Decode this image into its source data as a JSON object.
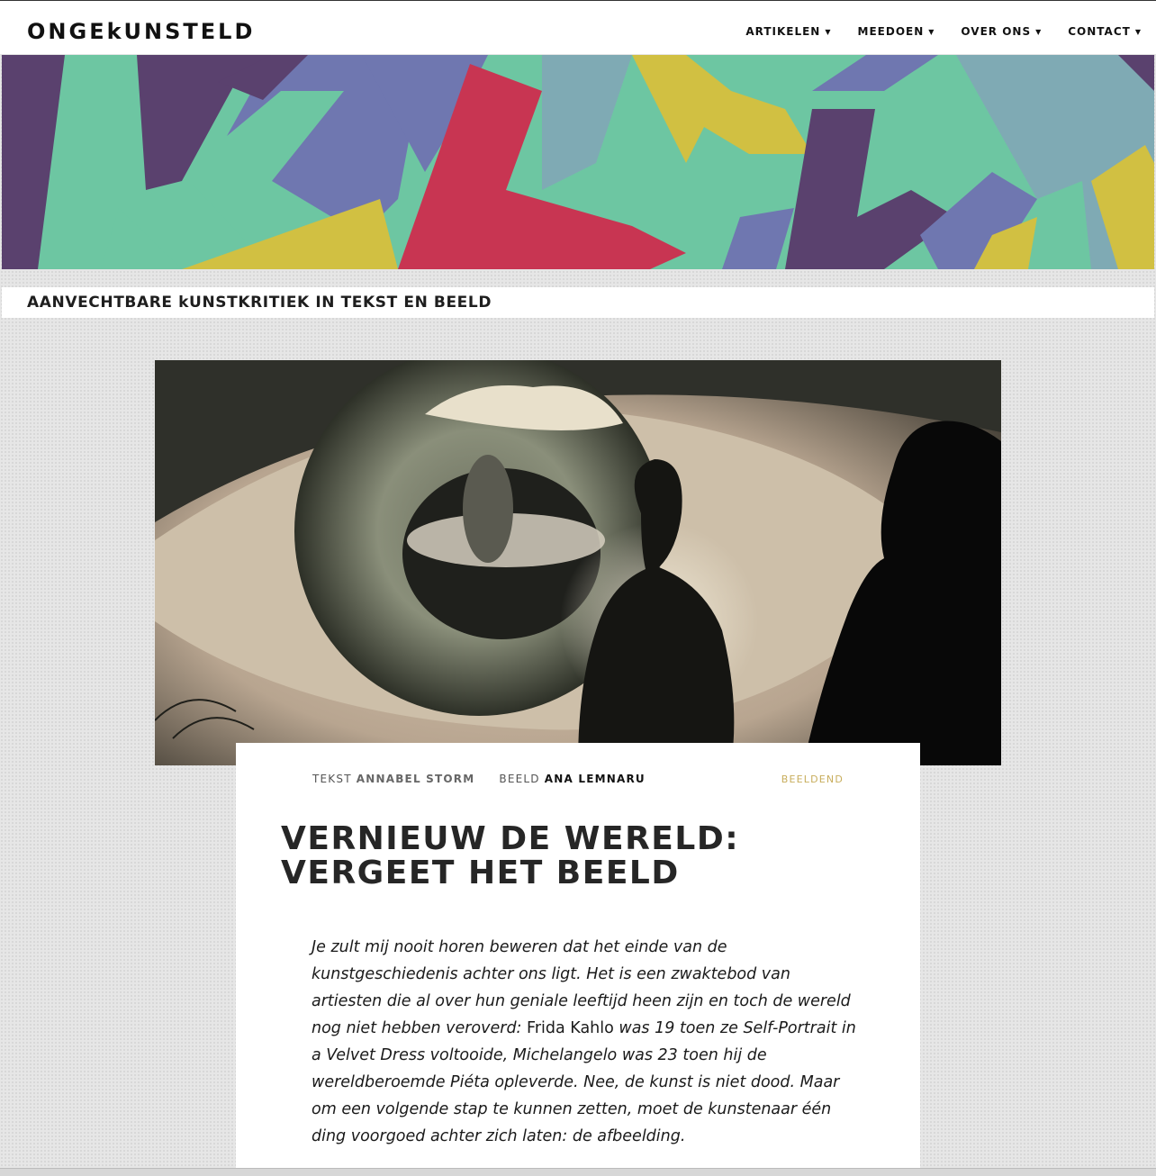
{
  "site": {
    "brand": "ONGEkUNSTELD",
    "tagline": "AANVECHTBARE kUNSTKRITIEK IN TEKST EN BEELD"
  },
  "nav": [
    {
      "label": "ARTIKELEN"
    },
    {
      "label": "MEEDOEN"
    },
    {
      "label": "OVER ONS"
    },
    {
      "label": "CONTACT"
    }
  ],
  "article": {
    "tekst_label": "TEKST",
    "author": "ANNABEL STORM",
    "beeld_label": "BEELD",
    "illustrator": "ANA LEMNARU",
    "category": "BEELDEND",
    "title": "VERNIEUW DE WERELD: VERGEET HET BEELD",
    "intro": {
      "p1": "Je zult mij nooit horen beweren dat het einde van de kunstgeschiedenis achter ons ligt. Het is een zwaktebod van artiesten die al over hun geniale leeftijd heen zijn en toch de wereld nog niet hebben veroverd: ",
      "name1": "Frida Kahlo",
      "p2": " was 19 toen ze Self-Portrait in a Velvet Dress voltooide, Michelangelo was 23 toen hij de wereldberoemde Piéta opleverde. Nee, de kunst is niet dood. Maar om een volgende stap te kunnen zetten, moet de kunstenaar één ding voorgoed achter zich laten: de afbeelding."
    }
  },
  "colors": {
    "banner_mint": "#6dc6a2",
    "banner_purple": "#5a416e",
    "banner_lavender": "#6f77b0",
    "banner_crimson": "#c83552",
    "banner_yellow": "#d1c042",
    "banner_teal": "#7faab4",
    "category_gold": "#c8ad5c"
  },
  "icons": {
    "caret": "caret-down-icon"
  }
}
